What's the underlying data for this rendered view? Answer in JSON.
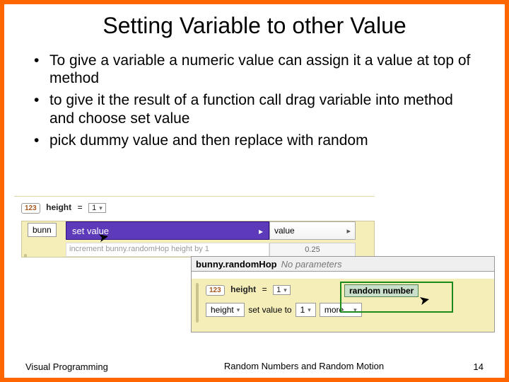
{
  "title": "Setting Variable to other Value",
  "bullets": [
    "To give a variable a numeric value can assign it a value at top of method",
    "to give it the result of a function call drag variable into method and choose set value",
    "pick dummy value and then replace with random"
  ],
  "snip1": {
    "type_badge": "123",
    "var": "height",
    "eq": "=",
    "val": "1",
    "bun": "bunn",
    "menu_set": "set value",
    "submenu": "value",
    "num_option": "0.25",
    "hidden_row": "increment bunny.randomHop height by 1"
  },
  "snip2": {
    "header_bold": "bunny.randomHop",
    "header_ital": "No parameters",
    "type_badge": "123",
    "var": "height",
    "eq": "=",
    "val": "1",
    "tile_height": "height",
    "set_text": "set  value to",
    "one": "1",
    "more": "more...",
    "rn": "random number"
  },
  "footer": {
    "left": "Visual Programming",
    "center": "Random Numbers and Random Motion",
    "page": "14"
  }
}
